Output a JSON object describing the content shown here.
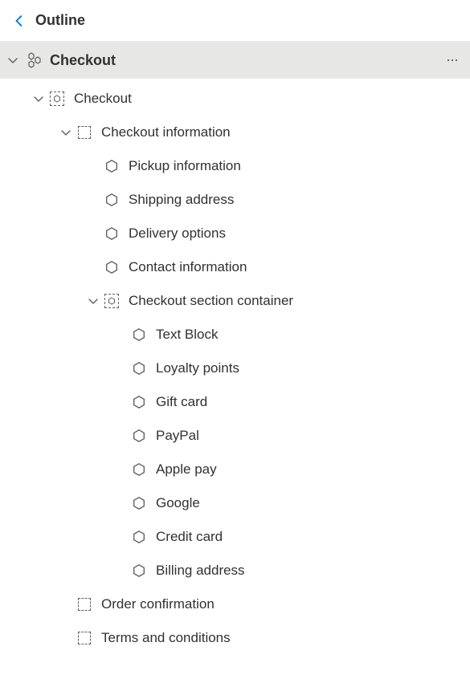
{
  "header": {
    "title": "Outline"
  },
  "root": {
    "label": "Checkout"
  },
  "tree": [
    {
      "depth": 0,
      "expanded": true,
      "icon": "container",
      "label": "Checkout"
    },
    {
      "depth": 1,
      "expanded": true,
      "icon": "slot",
      "label": "Checkout information"
    },
    {
      "depth": 2,
      "expanded": null,
      "icon": "module",
      "label": "Pickup information"
    },
    {
      "depth": 2,
      "expanded": null,
      "icon": "module",
      "label": "Shipping address"
    },
    {
      "depth": 2,
      "expanded": null,
      "icon": "module",
      "label": "Delivery options"
    },
    {
      "depth": 2,
      "expanded": null,
      "icon": "module",
      "label": "Contact information"
    },
    {
      "depth": 2,
      "expanded": true,
      "icon": "container",
      "label": "Checkout section container"
    },
    {
      "depth": 3,
      "expanded": null,
      "icon": "module",
      "label": "Text Block"
    },
    {
      "depth": 3,
      "expanded": null,
      "icon": "module",
      "label": "Loyalty points"
    },
    {
      "depth": 3,
      "expanded": null,
      "icon": "module",
      "label": "Gift card"
    },
    {
      "depth": 3,
      "expanded": null,
      "icon": "module",
      "label": "PayPal"
    },
    {
      "depth": 3,
      "expanded": null,
      "icon": "module",
      "label": "Apple pay"
    },
    {
      "depth": 3,
      "expanded": null,
      "icon": "module",
      "label": "Google"
    },
    {
      "depth": 3,
      "expanded": null,
      "icon": "module",
      "label": "Credit card"
    },
    {
      "depth": 3,
      "expanded": null,
      "icon": "module",
      "label": "Billing address"
    },
    {
      "depth": 1,
      "expanded": null,
      "icon": "slot",
      "label": "Order confirmation"
    },
    {
      "depth": 1,
      "expanded": null,
      "icon": "slot",
      "label": "Terms and conditions"
    }
  ]
}
